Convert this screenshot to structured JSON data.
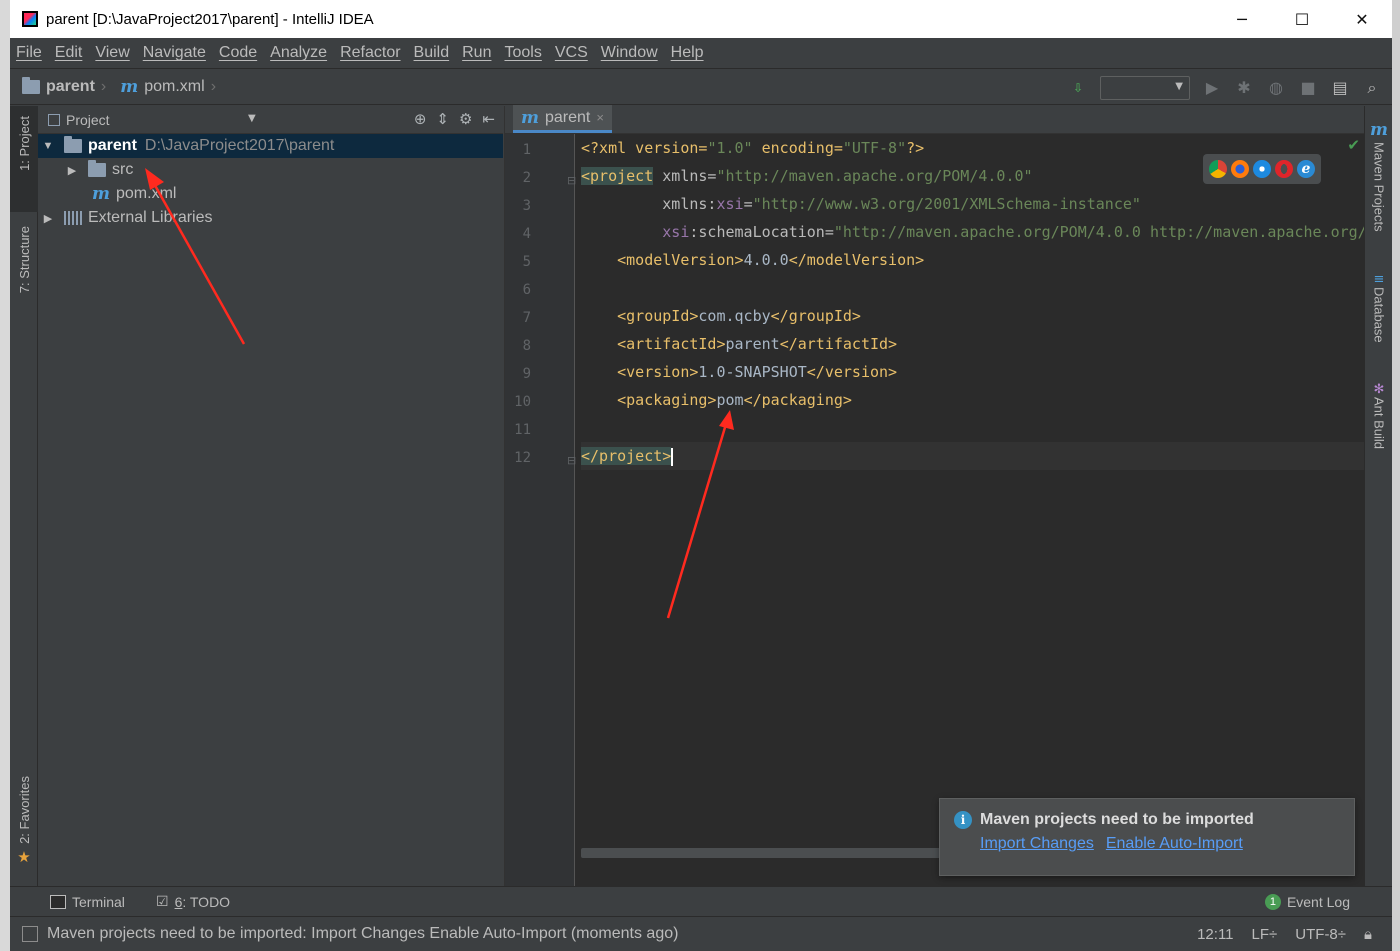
{
  "window": {
    "title": "parent [D:\\JavaProject2017\\parent] - IntelliJ IDEA",
    "controls": [
      "─",
      "☐",
      "✕"
    ]
  },
  "menu": [
    "File",
    "Edit",
    "View",
    "Navigate",
    "Code",
    "Analyze",
    "Refactor",
    "Build",
    "Run",
    "Tools",
    "VCS",
    "Window",
    "Help"
  ],
  "breadcrumb": {
    "project": "parent",
    "file": "pom.xml"
  },
  "left_tabs": {
    "project": "1: Project",
    "structure": "7: Structure",
    "favorites": "2: Favorites"
  },
  "right_tabs": {
    "maven": "Maven Projects",
    "database": "Database",
    "ant": "Ant Build"
  },
  "project_panel": {
    "header": "Project",
    "tree": {
      "root_name": "parent",
      "root_path": "D:\\JavaProject2017\\parent",
      "src": "src",
      "pom": "pom.xml",
      "external": "External Libraries"
    }
  },
  "editor": {
    "tab_label": "parent",
    "tab_close": "×",
    "line_numbers": [
      "1",
      "2",
      "3",
      "4",
      "5",
      "6",
      "7",
      "8",
      "9",
      "10",
      "11",
      "12"
    ],
    "code": {
      "l1": {
        "a": "<?xml version=",
        "b": "\"1.0\"",
        "c": " encoding=",
        "d": "\"UTF-8\"",
        "e": "?>"
      },
      "l2": {
        "a": "<project",
        "b": " xmlns=",
        "c": "\"http://maven.apache.org/POM/4.0.0\""
      },
      "l3": {
        "a": "         xmlns:",
        "b": "xsi",
        "c": "=",
        "d": "\"http://www.w3.org/2001/XMLSchema-instance\""
      },
      "l4": {
        "a": "         ",
        "b": "xsi",
        "c": ":schemaLocation=",
        "d": "\"http://maven.apache.org/POM/4.0.0 http://maven.apache.org/"
      },
      "l5": {
        "a": "    <modelVersion>",
        "b": "4.0.0",
        "c": "</modelVersion>"
      },
      "l7": {
        "a": "    <groupId>",
        "b": "com.qcby",
        "c": "</groupId>"
      },
      "l8": {
        "a": "    <artifactId>",
        "b": "parent",
        "c": "</artifactId>"
      },
      "l9": {
        "a": "    <version>",
        "b": "1.0-SNAPSHOT",
        "c": "</version>"
      },
      "l10": {
        "a": "    <packaging>",
        "b": "pom",
        "c": "</packaging>"
      },
      "l12": {
        "a": "</project",
        "b": ">"
      }
    }
  },
  "notification": {
    "title": "Maven projects need to be imported",
    "import_link": "Import Changes",
    "auto_import_link": "Enable Auto-Import"
  },
  "bottom_tools": {
    "terminal": "Terminal",
    "todo_num": "6",
    "todo_label": ": TODO",
    "event_log": "Event Log",
    "event_badge": "1"
  },
  "status": {
    "message": "Maven projects need to be imported: Import Changes   Enable Auto-Import (moments ago)",
    "position": "12:11",
    "line_sep": "LF÷",
    "encoding": "UTF-8÷"
  },
  "colors": {
    "annotation_arrow": "#ff2a1f",
    "accent": "#4a88c7",
    "link": "#589df6"
  }
}
